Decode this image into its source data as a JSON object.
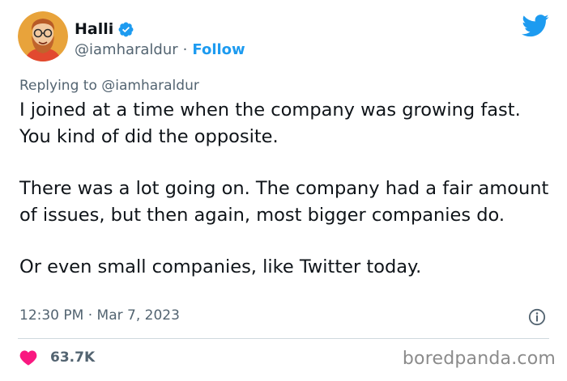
{
  "author": {
    "name": "Halli",
    "handle": "@iamharaldur",
    "separator": "·",
    "follow_label": "Follow",
    "verified": true
  },
  "reply": {
    "prefix": "Replying to",
    "mention": "@iamharaldur"
  },
  "body": {
    "paragraphs": [
      "I joined at a time when the company was growing fast. You kind of did the opposite.",
      "There was a lot going on. The company had a fair amount of issues, but then again, most bigger companies do.",
      "Or even small companies, like Twitter today."
    ]
  },
  "meta": {
    "time": "12:30 PM",
    "separator": "·",
    "date": "Mar 7, 2023"
  },
  "engagement": {
    "likes": "63.7K"
  },
  "watermark": "boredpanda.com",
  "colors": {
    "accent": "#1d9bf0",
    "heart": "#f91880",
    "muted_text": "#536471",
    "text": "#0f1419",
    "divider": "#cfd9de"
  },
  "icons": [
    "avatar",
    "verified-badge-icon",
    "twitter-bird-icon",
    "info-icon",
    "heart-icon"
  ]
}
